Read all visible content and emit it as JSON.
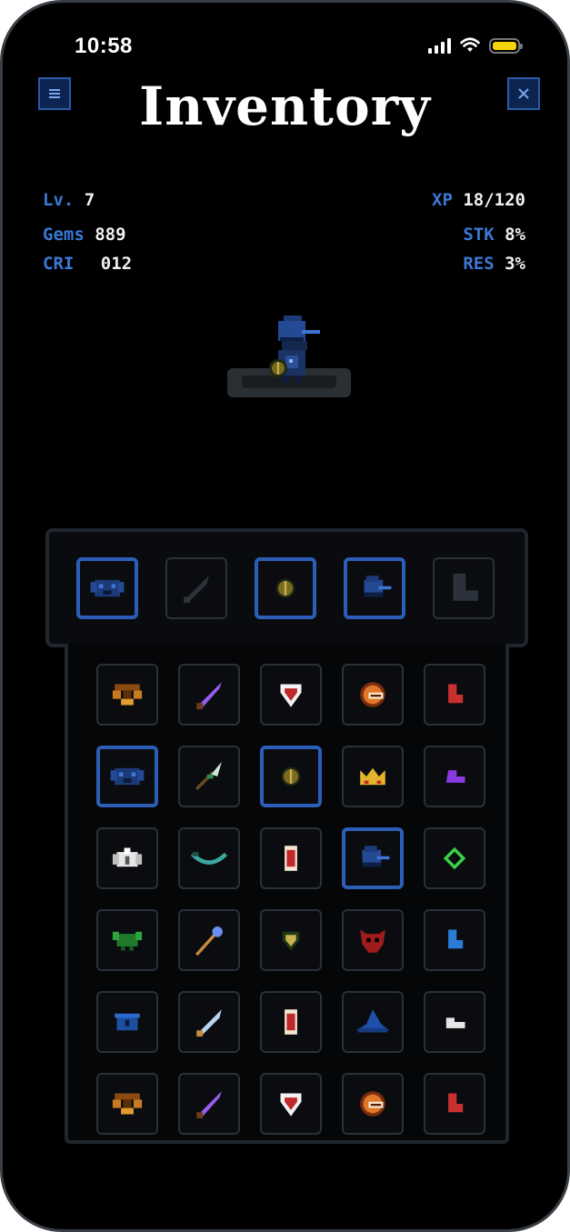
{
  "status": {
    "time": "10:58"
  },
  "header": {
    "title": "Inventory",
    "menu_icon": "menu-icon",
    "close_icon": "close-icon"
  },
  "stats": {
    "level": {
      "label": "Lv.",
      "value": "7"
    },
    "xp": {
      "label": "XP",
      "value": "18/120"
    },
    "gems": {
      "label": "Gems",
      "value": "889"
    },
    "atk": {
      "label": "STK",
      "value": "8%"
    },
    "cri": {
      "label": "CRI",
      "value": "012"
    },
    "res": {
      "label": "RES",
      "value": "3%"
    }
  },
  "equipment": [
    "chest-armor",
    "sword-empty",
    "shield-round",
    "helmet",
    "boots-empty"
  ],
  "inventory": [
    [
      "bow-orange",
      "dagger-purple",
      "shield-white",
      "helmet-orange",
      "boots-red"
    ],
    [
      "chest-armor",
      "spear-green",
      "shield-round",
      "crown",
      "boots-purple"
    ],
    [
      "chest-white",
      "bow-teal",
      "scroll-red",
      "helmet",
      "ring-green"
    ],
    [
      "chest-green",
      "staff-blue",
      "shield-green",
      "mask-red",
      "boots-blue"
    ],
    [
      "chest-blue",
      "sword-blue",
      "scroll-red",
      "hat-blue",
      "boots-white"
    ],
    [
      "bow-orange",
      "dagger-purple",
      "shield-white",
      "helmet-orange",
      "boots-red"
    ]
  ]
}
